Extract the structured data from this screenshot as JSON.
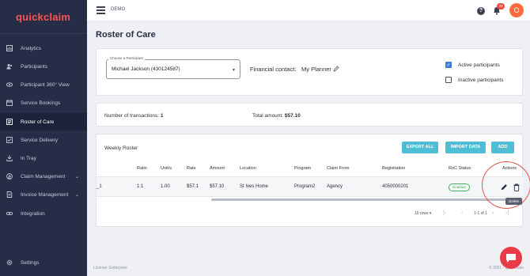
{
  "app": {
    "logo": "quickclaim",
    "env_label": "DEMO"
  },
  "topbar": {
    "notification_count": "33",
    "avatar_initial": "O"
  },
  "sidebar": {
    "items": [
      {
        "label": "Analytics",
        "icon": "analytics-icon"
      },
      {
        "label": "Participants",
        "icon": "participants-icon"
      },
      {
        "label": "Participant 360° View",
        "icon": "eye-icon"
      },
      {
        "label": "Service Bookings",
        "icon": "calendar-icon"
      },
      {
        "label": "Roster of Care",
        "icon": "roster-icon"
      },
      {
        "label": "Service Delivery",
        "icon": "delivery-icon"
      },
      {
        "label": "In Tray",
        "icon": "download-icon"
      },
      {
        "label": "Claim Management",
        "icon": "claim-icon"
      },
      {
        "label": "Invoice Management",
        "icon": "invoice-icon"
      },
      {
        "label": "Integration",
        "icon": "link-icon"
      },
      {
        "label": "Settings",
        "icon": "gear-icon"
      }
    ]
  },
  "page": {
    "title": "Roster of Care"
  },
  "filters": {
    "participant_legend": "Choose a Participant",
    "participant_value": "Michael Jackson (430124587)",
    "financial_contact_label": "Financial contact:",
    "financial_contact_value": "My Planner",
    "active_label": "Active participants",
    "active_checked": true,
    "inactive_label": "Inactive participants",
    "inactive_checked": false
  },
  "summary": {
    "transactions_label": "Number of transactions:",
    "transactions_value": "1",
    "total_label": "Total amount:",
    "total_value": "$57.10"
  },
  "roster": {
    "title": "Weekly Roster",
    "buttons": {
      "export": "EXPORT ALL",
      "import": "IMPORT DATA",
      "add": "ADD"
    },
    "columns": [
      "Ratio",
      "Unit/s",
      "Rate",
      "Amount",
      "Location",
      "Program",
      "Claim From",
      "Registration",
      "RoC Status",
      "Actions"
    ],
    "rows": [
      {
        "lead": "_1",
        "ratio": "1:1",
        "units": "1.00",
        "rate": "$57.1",
        "amount": "$57.10",
        "location": "St Ives Home",
        "program": "Program2",
        "claim_from": "Agency",
        "registration": "4050000201",
        "status": "Enabled"
      }
    ],
    "pagination": {
      "rows_label": "10 rows",
      "range": "1-1 of 1"
    },
    "tooltip": "Delete"
  },
  "footer": {
    "license": "License: Enterprise",
    "copyright": "© 2021 - quickclaim"
  },
  "colors": {
    "sidebar": "#262e47",
    "brand": "#ff5252",
    "button": "#4fbdd6",
    "status": "#43b05c",
    "fab": "#ea3a4a"
  }
}
